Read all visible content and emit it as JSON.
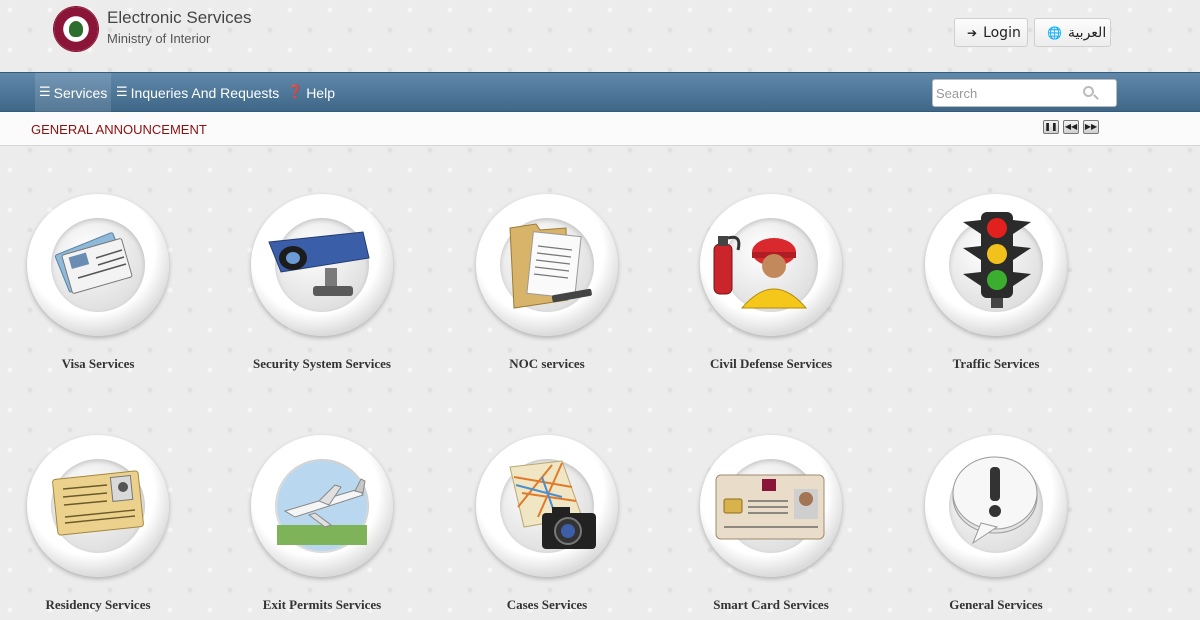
{
  "header": {
    "title": "Electronic Services",
    "subtitle": "Ministry of Interior",
    "login_label": "Login",
    "lang_label": "العربية"
  },
  "nav": {
    "items": [
      {
        "label": "Services",
        "icon": "list-icon"
      },
      {
        "label": "Inqueries And Requests",
        "icon": "list-icon"
      },
      {
        "label": "Help",
        "icon": "question-circle-icon"
      }
    ],
    "search_placeholder": "Search"
  },
  "announcement": {
    "label": "GENERAL ANNOUNCEMENT",
    "controls": [
      "pause-icon",
      "rewind-icon",
      "forward-icon"
    ]
  },
  "services": [
    {
      "label": "Visa Services",
      "icon": "visa-cards-icon"
    },
    {
      "label": "Security System Services",
      "icon": "security-camera-icon"
    },
    {
      "label": "NOC services",
      "icon": "document-folder-icon"
    },
    {
      "label": "Civil Defense Services",
      "icon": "firefighter-icon"
    },
    {
      "label": "Traffic Services",
      "icon": "traffic-light-icon"
    },
    {
      "label": "Residency Services",
      "icon": "id-document-icon"
    },
    {
      "label": "Exit Permits Services",
      "icon": "airplane-icon"
    },
    {
      "label": "Cases Services",
      "icon": "map-camera-icon"
    },
    {
      "label": "Smart Card Services",
      "icon": "id-card-icon"
    },
    {
      "label": "General Services",
      "icon": "exclamation-bubble-icon"
    }
  ],
  "colors": {
    "nav_bar": "#4b7495",
    "announcement_text": "#8b1010",
    "brand_maroon": "#8a1538"
  }
}
